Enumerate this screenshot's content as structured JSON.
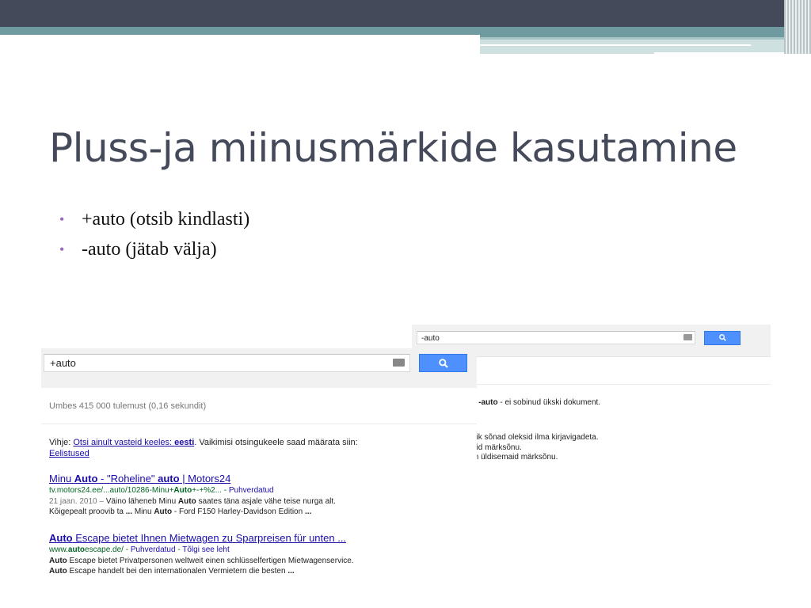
{
  "slide": {
    "title": "Pluss-ja miinusmärkide kasutamine",
    "bullets": [
      {
        "marker": "•",
        "text": "+auto (otsib kindlasti)"
      },
      {
        "marker": "•",
        "text": "-auto (jätab välja)"
      }
    ],
    "colors": {
      "title": "#454a5a",
      "bullet": "#9a6ab8",
      "top_bar": "#444a5a",
      "accent": "#6f9ba0"
    }
  },
  "screenshot_minus": {
    "search_value": "-auto",
    "keyboard_icon": "keyboard-icon",
    "search_icon": "search-icon",
    "no_results_prefix": "- ",
    "no_results_term": "-auto",
    "no_results_suffix": " - ei sobinud ükski dokument.",
    "suggestions": [
      "õik sõnad oleksid ilma kirjavigadeta.",
      "aid märksõnu.",
      "m üldisemaid märksõnu."
    ]
  },
  "screenshot_plus": {
    "search_value": "+auto",
    "keyboard_icon": "keyboard-icon",
    "search_icon": "search-icon",
    "stats": "Umbes 415 000 tulemust (0,16 sekundit)",
    "hint": {
      "prefix": "Vihje: ",
      "link_text": "Otsi ainult vasteid keeles: ",
      "link_bold": "eesti",
      "suffix": ". Vaikimisi otsingukeele saad määrata siin:",
      "settings_link": "Eelistused"
    },
    "results": [
      {
        "title_a": "Minu ",
        "title_b": "Auto",
        "title_c": " - \"Roheline\" ",
        "title_d": "auto",
        "title_e": " | Motors24",
        "url_a": "tv.motors24.ee/...auto/10286-Minu+",
        "url_b": "Auto",
        "url_c": "+-+%2... - ",
        "url_link": "Puhverdatud",
        "date": "21 jaan. 2010 – ",
        "snip1_a": "Väino läheneb Minu ",
        "snip1_b": "Auto",
        "snip1_c": " saates täna asjale vähe teise nurga alt.",
        "snip2_a": "Kõigepealt proovib ta ",
        "snip2_b": "...",
        "snip2_c": " Minu ",
        "snip2_d": "Auto",
        "snip2_e": " - Ford F150 Harley-Davidson Edition ",
        "snip2_f": "..."
      },
      {
        "title_a": "Auto",
        "title_b": " Escape bietet Ihnen Mietwagen zu Sparpreisen für unten ...",
        "url_a": "www.",
        "url_b": "auto",
        "url_c": "escape.de/ - ",
        "url_link": "Puhverdatud",
        "url_sep": " - ",
        "url_link2": "Tõlgi see leht",
        "snip1_a": "Auto",
        "snip1_b": " Escape bietet Privatpersonen weltweit einen schlüsselfertigen Mietwagenservice.",
        "snip2_a": "Auto",
        "snip2_b": " Escape handelt bei den internationalen Vermietern die besten ",
        "snip2_c": "..."
      }
    ]
  }
}
